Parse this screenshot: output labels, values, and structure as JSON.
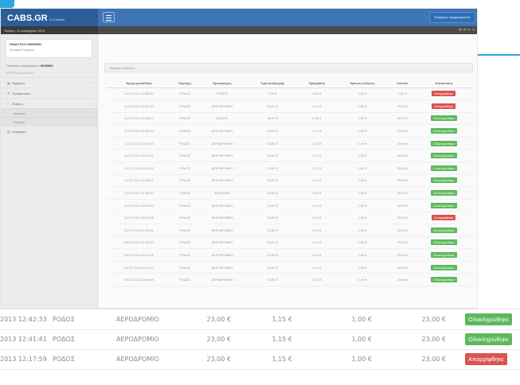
{
  "app": {
    "brand": "CABS.GR",
    "brand_sub": "v1.0 admin",
    "date_line": "Τετάρτη, 11 Δεκεμβρίου 2013",
    "user_menu": "Ενέργειες λογαριασμού ▾",
    "sub_icons": "⚙ ✉  ✕ ✕"
  },
  "sidebar": {
    "profile_name": "ΡΑΔΙΟΤΑΞΙ ΑΘΗΝΩΝ",
    "profile_role": "Κεντρικό Γραφείο",
    "balance_label": "Υπόλοιπο λογαριασμού:",
    "balance_value": "€000000",
    "nav_heading": "ΚΕΝΤΡΙΚΟ ΜΕΝΟΥ",
    "items": [
      {
        "label": "Οχήματα",
        "icon": "car-icon"
      },
      {
        "label": "Τηλεφωνητές",
        "icon": "phone-icon"
      },
      {
        "label": "Κλήσεις",
        "icon": "list-icon"
      }
    ],
    "subitems": [
      "Ιστορικό",
      "Ενεργές"
    ],
    "last_item": {
      "label": "Αναφορές",
      "icon": "chart-icon"
    }
  },
  "panel": {
    "title": "Ιστορικό κλήσεων"
  },
  "table": {
    "headers": [
      "Ημερομηνία/Ώρα",
      "Περιοχή",
      "Προορισμός",
      "Τιμή Διαδρομής",
      "Προμήθεια",
      "Χρέωση Κλήσης",
      "Σύνολο",
      "Κατάσταση"
    ],
    "rows": [
      [
        "11.07.2013 12:55:50",
        "ΡΟΔΟΣ",
        "ΡΟΔΟΣ",
        "7,00 €",
        "0,00 €",
        "0,00 €",
        "7,00 €",
        "Απορρίφθηκε",
        "no"
      ],
      [
        "11.07.2013 12:51:40",
        "ΡΟΔΟΣ",
        "ΑΕΡΟΔΡΟΜΙΟ",
        "23,00 €",
        "1,15 €",
        "1,00 €",
        "23,00 €",
        "Απορρίφθηκε",
        "no"
      ],
      [
        "11.07.2013 12:46:59",
        "ΡΟΔΟΣ",
        "ΛΙΝΔΟΣ",
        "48,00 €",
        "2,40 €",
        "1,00 €",
        "48,00 €",
        "Ολοκληρώθηκε",
        "ok"
      ],
      [
        "11.07.2013 12:39:15",
        "ΡΟΔΟΣ",
        "ΑΕΡΟΔΡΟΜΙΟ",
        "23,00 €",
        "1,15 €",
        "1,00 €",
        "23,00 €",
        "Ολοκληρώθηκε",
        "ok"
      ],
      [
        "11.07.2013 12:30:02",
        "ΡΟΔΟΣ",
        "ΑΕΡΟΔΡΟΜΙΟ",
        "23,00 €",
        "1,15 €",
        "1,00 €",
        "23,00 €",
        "Ολοκληρώθηκε",
        "ok"
      ],
      [
        "11.07.2013 12:21:48",
        "ΡΟΔΟΣ",
        "ΑΕΡΟΔΡΟΜΙΟ",
        "23,00 €",
        "1,15 €",
        "1,00 €",
        "23,00 €",
        "Ολοκληρώθηκε",
        "ok"
      ],
      [
        "11.07.2013 12:14:33",
        "ΡΟΔΟΣ",
        "ΑΕΡΟΔΡΟΜΙΟ",
        "23,00 €",
        "1,15 €",
        "1,00 €",
        "23,00 €",
        "Ολοκληρώθηκε",
        "ok"
      ],
      [
        "11.07.2013 12:05:11",
        "ΡΟΔΟΣ",
        "ΑΕΡΟΔΡΟΜΙΟ",
        "23,00 €",
        "1,15 €",
        "1,00 €",
        "23,00 €",
        "Ολοκληρώθηκε",
        "ok"
      ],
      [
        "11.07.2013 11:58:40",
        "ΡΟΔΟΣ",
        "ΦΑΛΗΡΑΚΙ",
        "18,00 €",
        "0,90 €",
        "1,00 €",
        "18,00 €",
        "Ολοκληρώθηκε",
        "ok"
      ],
      [
        "10.07.2013 19:42:20",
        "ΡΟΔΟΣ",
        "ΑΕΡΟΔΡΟΜΙΟ",
        "23,00 €",
        "1,15 €",
        "1,00 €",
        "23,00 €",
        "Ολοκληρώθηκε",
        "ok"
      ],
      [
        "10.07.2013 18:37:05",
        "ΡΟΔΟΣ",
        "ΑΕΡΟΔΡΟΜΙΟ",
        "23,00 €",
        "1,15 €",
        "1,00 €",
        "23,00 €",
        "Απορρίφθηκε",
        "no"
      ],
      [
        "10.07.2013 17:29:51",
        "ΡΟΔΟΣ",
        "ΑΕΡΟΔΡΟΜΙΟ",
        "23,00 €",
        "1,15 €",
        "1,00 €",
        "23,00 €",
        "Ολοκληρώθηκε",
        "ok"
      ],
      [
        "09.07.2013 21:16:44",
        "ΡΟΔΟΣ",
        "ΑΕΡΟΔΡΟΜΙΟ",
        "23,00 €",
        "1,15 €",
        "1,00 €",
        "23,00 €",
        "Ολοκληρώθηκε",
        "ok"
      ],
      [
        "09.07.2013 20:03:18",
        "ΡΟΔΟΣ",
        "ΑΕΡΟΔΡΟΜΙΟ",
        "23,00 €",
        "1,15 €",
        "1,00 €",
        "23,00 €",
        "Ολοκληρώθηκε",
        "ok"
      ],
      [
        "09.07.2013 19:11:27",
        "ΡΟΔΟΣ",
        "ΑΕΡΟΔΡΟΜΙΟ",
        "23,00 €",
        "1,15 €",
        "1,00 €",
        "23,00 €",
        "Ολοκληρώθηκε",
        "ok"
      ],
      [
        "09.07.2013 18:25:09",
        "ΡΟΔΟΣ",
        "ΑΕΡΟΔΡΟΜΙΟ",
        "23,00 €",
        "1,15 €",
        "1,00 €",
        "23,00 €",
        "Ολοκληρώθηκε",
        "ok"
      ]
    ]
  },
  "zoom_rows": [
    [
      "2013 12:42:33",
      "ΡΟΔΟΣ",
      "ΑΕΡΟΔΡΟΜΙΟ",
      "23,00 €",
      "1,15 €",
      "1,00 €",
      "23,00 €",
      "Ολοκληρώθηκε",
      "ok"
    ],
    [
      "2013 12:41:41",
      "ΡΟΔΟΣ",
      "ΑΕΡΟΔΡΟΜΙΟ",
      "23,00 €",
      "1,15 €",
      "1,00 €",
      "23,00 €",
      "Ολοκληρώθηκε",
      "ok"
    ],
    [
      "2013 12:17:59",
      "ΡΟΔΟΣ",
      "ΑΕΡΟΔΡΟΜΙΟ",
      "23,00 €",
      "1,15 €",
      "1,00 €",
      "23,00 €",
      "Απορρίφθηκε",
      "no"
    ]
  ],
  "colors": {
    "topbar": "#3f74b5",
    "brand_bg": "#2b5d99",
    "accent": "#29a9e0",
    "success": "#5cb85c",
    "danger": "#d9534f"
  }
}
